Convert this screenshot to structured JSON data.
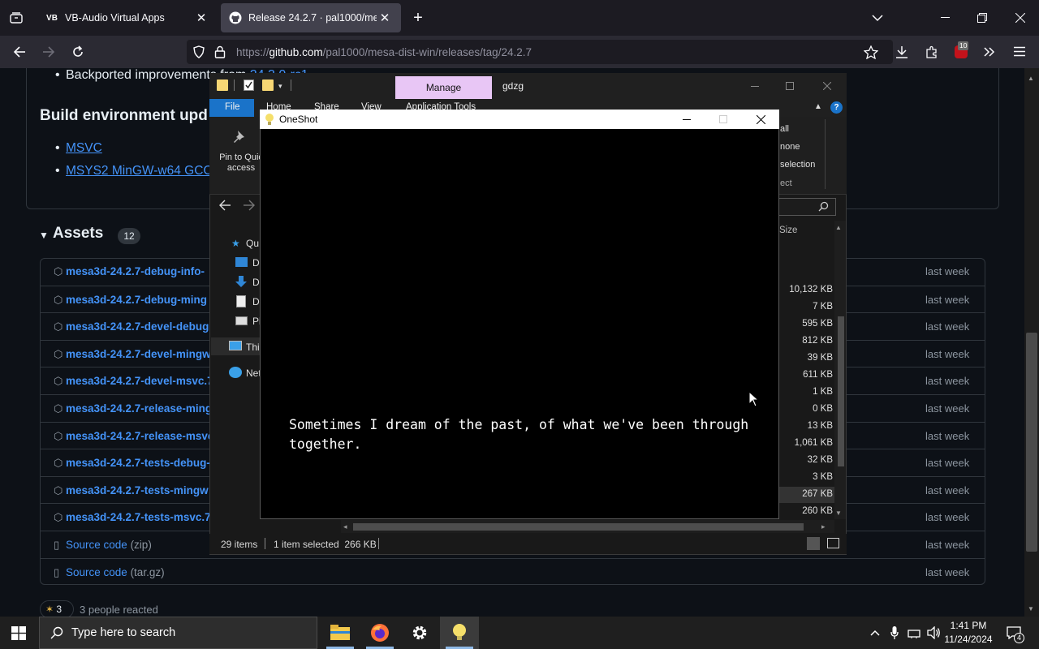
{
  "browser": {
    "tabs": [
      {
        "label": "VB-Audio Virtual Apps",
        "favicon": "VB"
      },
      {
        "label": "Release 24.2.7 · pal1000/mesa-d",
        "favicon": "github-icon"
      }
    ],
    "url_prefix": "https://",
    "url_host": "github.com",
    "url_path": "/pal1000/mesa-dist-win/releases/tag/24.2.7",
    "extensions_badge": "10"
  },
  "github": {
    "bullet_top": "Backported improvements from",
    "bullet_top_link": "24.3.0-rc1",
    "build_heading": "Build environment upd",
    "build_links": [
      "MSVC",
      "MSYS2 MinGW-w64 GCC"
    ],
    "assets_title": "Assets",
    "assets_count": "12",
    "assets": [
      {
        "name": "mesa3d-24.2.7-debug-info-",
        "time": "last week"
      },
      {
        "name": "mesa3d-24.2.7-debug-ming",
        "time": "last week"
      },
      {
        "name": "mesa3d-24.2.7-devel-debug",
        "time": "last week"
      },
      {
        "name": "mesa3d-24.2.7-devel-mingw",
        "time": "last week"
      },
      {
        "name": "mesa3d-24.2.7-devel-msvc.7",
        "time": "last week"
      },
      {
        "name": "mesa3d-24.2.7-release-ming",
        "time": "last week"
      },
      {
        "name": "mesa3d-24.2.7-release-msvc",
        "time": "last week"
      },
      {
        "name": "mesa3d-24.2.7-tests-debug-",
        "time": "last week"
      },
      {
        "name": "mesa3d-24.2.7-tests-mingw",
        "time": "last week"
      },
      {
        "name": "mesa3d-24.2.7-tests-msvc.7",
        "time": "last week"
      }
    ],
    "source": [
      {
        "name": "Source code",
        "ext": "(zip)",
        "time": "last week"
      },
      {
        "name": "Source code",
        "ext": "(tar.gz)",
        "time": "last week"
      }
    ],
    "reaction_count": "3",
    "reaction_text": "3 people reacted"
  },
  "explorer": {
    "manage_label": "Manage",
    "folder_title": "gdzg",
    "ribbon_tabs": [
      "File",
      "Home",
      "Share",
      "View",
      "Application Tools"
    ],
    "pin_label_1": "Pin to Quic",
    "pin_label_2": "access",
    "select_items": [
      "all",
      "none",
      "selection",
      "ect"
    ],
    "nav_items": [
      "Qu",
      "D",
      "D",
      "D",
      "Pi",
      "Thi",
      "Net"
    ],
    "size_header": "Size",
    "sizes": [
      "10,132 KB",
      "7 KB",
      "595 KB",
      "812 KB",
      "39 KB",
      "611 KB",
      "1 KB",
      "0 KB",
      "13 KB",
      "1,061 KB",
      "32 KB",
      "3 KB",
      "267 KB",
      "260 KB"
    ],
    "status_items": "29 items",
    "status_selected": "1 item selected  266 KB"
  },
  "oneshot": {
    "title": "OneShot",
    "dialog": "Sometimes I dream of the past, of what we've been through together."
  },
  "taskbar": {
    "search_placeholder": "Type here to search",
    "time": "1:41 PM",
    "date": "11/24/2024",
    "notif_count": "4"
  }
}
